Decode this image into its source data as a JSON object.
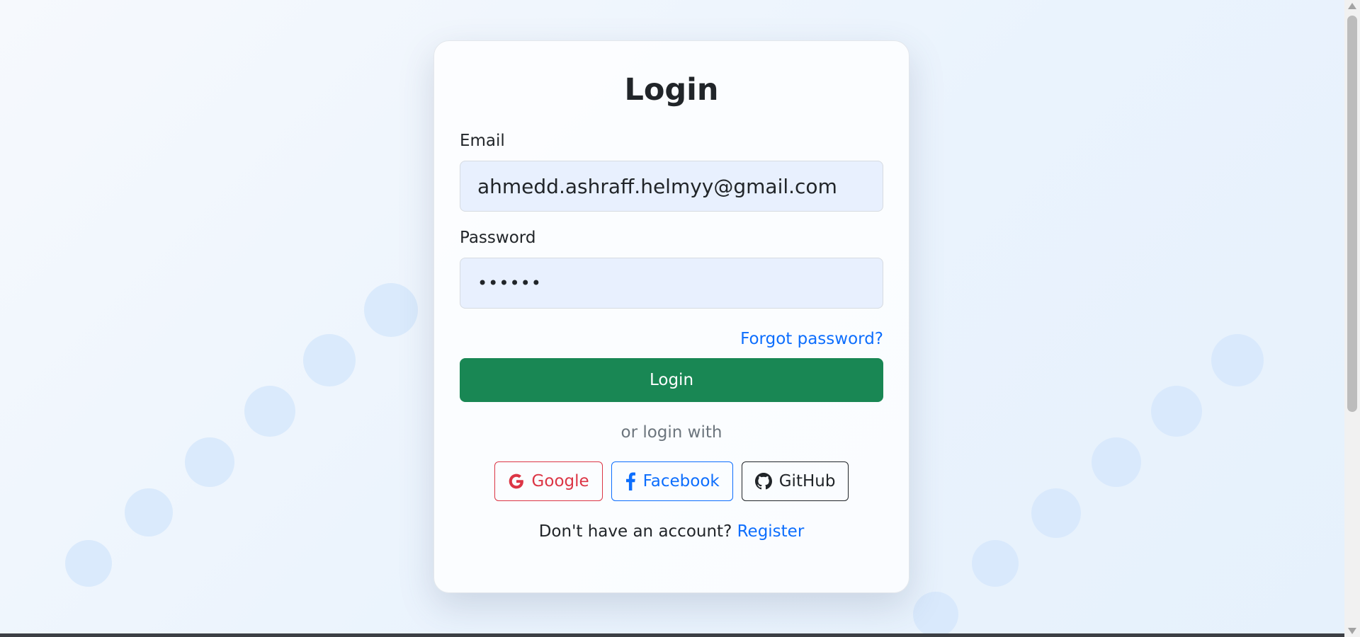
{
  "login_form": {
    "title": "Login",
    "email_label": "Email",
    "email_value": "ahmedd.ashraff.helmyy@gmail.com",
    "password_label": "Password",
    "password_value": "••••••",
    "forgot_password": "Forgot password?",
    "submit_label": "Login",
    "social_divider": "or login with",
    "social": [
      {
        "label": "Google",
        "icon": "google-icon",
        "color": "#dc3545"
      },
      {
        "label": "Facebook",
        "icon": "facebook-icon",
        "color": "#0d6efd"
      },
      {
        "label": "GitHub",
        "icon": "github-icon",
        "color": "#212529"
      }
    ],
    "register_prompt": "Don't have an account?",
    "register_link": "Register"
  },
  "colors": {
    "primary_button": "#198754",
    "link": "#0d6efd",
    "input_background": "#e8f0fe"
  }
}
